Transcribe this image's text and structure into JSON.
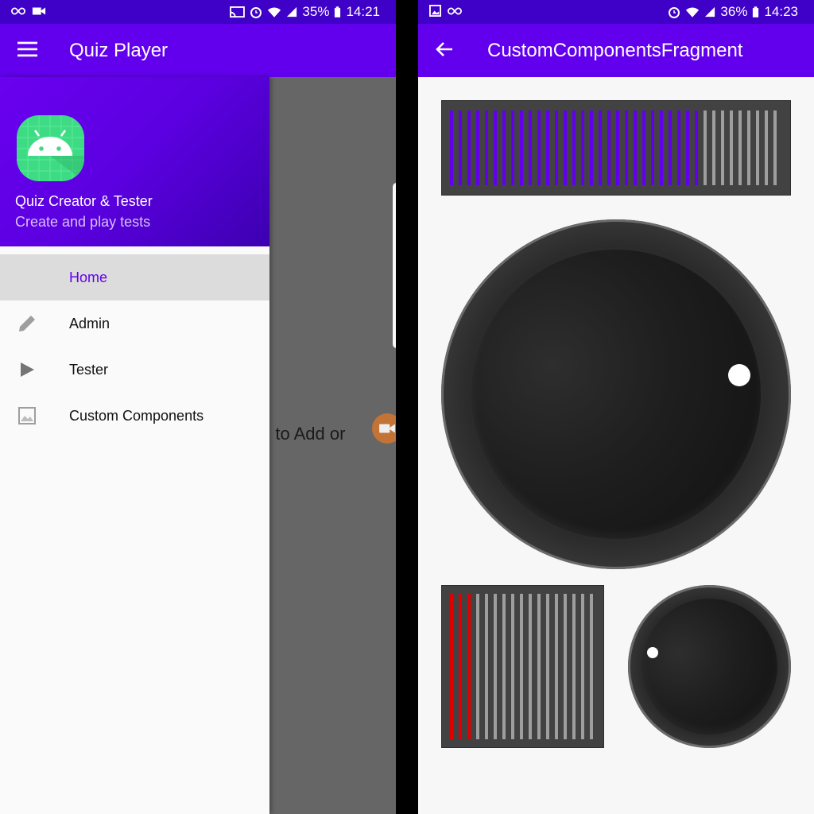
{
  "left": {
    "status": {
      "battery": "35%",
      "time": "14:21"
    },
    "appbar": {
      "title": "Quiz Player"
    },
    "background_text": {
      "line1": "u to Add or",
      "line2": "!"
    },
    "drawer": {
      "header_title": "Quiz Creator & Tester",
      "header_subtitle": "Create and play tests",
      "items": [
        {
          "label": "Home",
          "icon": "none",
          "selected": true
        },
        {
          "label": "Admin",
          "icon": "pencil-icon"
        },
        {
          "label": "Tester",
          "icon": "play-icon"
        },
        {
          "label": "Custom Components",
          "icon": "image-icon"
        }
      ]
    }
  },
  "right": {
    "status": {
      "battery": "36%",
      "time": "14:23"
    },
    "appbar": {
      "title": "CustomComponentsFragment"
    },
    "meter_top": {
      "active_fraction": 0.75,
      "active_color": "#6200ee",
      "inactive_color": "#9e9e9e"
    },
    "meter_small": {
      "active_fraction": 0.2,
      "active_color": "#e00000",
      "inactive_color": "#9e9e9e"
    }
  },
  "colors": {
    "primary": "#6200ee",
    "status_bar": "#3f00c8",
    "drawer_selected_bg": "#dcdcdc"
  }
}
